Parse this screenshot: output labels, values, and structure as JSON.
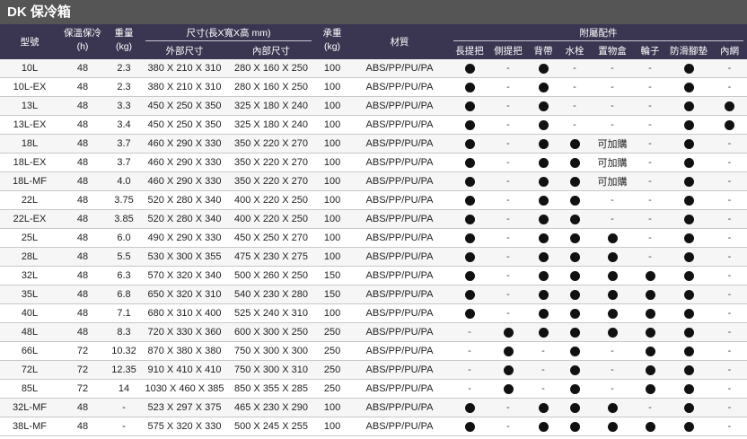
{
  "title": "DK 保冷箱",
  "headers": {
    "model": "型號",
    "hours_label": "保溫保冷",
    "hours_unit": "(h)",
    "weight_label": "重量",
    "weight_unit": "(kg)",
    "size_group": "尺寸(長X寬X高 mm)",
    "outer": "外部尺寸",
    "inner": "內部尺寸",
    "load_label": "承重",
    "load_unit": "(kg)",
    "material": "材質",
    "accessories_group": "附屬配件",
    "accessories": [
      "長提把",
      "側提把",
      "背帶",
      "水栓",
      "置物盒",
      "輪子",
      "防滑腳墊",
      "內網"
    ]
  },
  "rows": [
    {
      "model": "10L",
      "hours": "48",
      "weight": "2.3",
      "outer": "380 X 210 X 310",
      "inner": "280 X 160 X 250",
      "load": "100",
      "material": "ABS/PP/PU/PA",
      "acc": [
        "dot",
        "-",
        "dot",
        "-",
        "-",
        "-",
        "dot",
        "-"
      ]
    },
    {
      "model": "10L-EX",
      "hours": "48",
      "weight": "2.3",
      "outer": "380 X 210 X 310",
      "inner": "280 X 160 X 250",
      "load": "100",
      "material": "ABS/PP/PU/PA",
      "acc": [
        "dot",
        "-",
        "dot",
        "-",
        "-",
        "-",
        "dot",
        "-"
      ]
    },
    {
      "model": "13L",
      "hours": "48",
      "weight": "3.3",
      "outer": "450 X 250 X 350",
      "inner": "325 X 180 X 240",
      "load": "100",
      "material": "ABS/PP/PU/PA",
      "acc": [
        "dot",
        "-",
        "dot",
        "-",
        "-",
        "-",
        "dot",
        "dot"
      ]
    },
    {
      "model": "13L-EX",
      "hours": "48",
      "weight": "3.4",
      "outer": "450 X 250 X 350",
      "inner": "325 X 180 X 240",
      "load": "100",
      "material": "ABS/PP/PU/PA",
      "acc": [
        "dot",
        "-",
        "dot",
        "-",
        "-",
        "-",
        "dot",
        "dot"
      ]
    },
    {
      "model": "18L",
      "hours": "48",
      "weight": "3.7",
      "outer": "460 X 290 X 330",
      "inner": "350 X 220 X 270",
      "load": "100",
      "material": "ABS/PP/PU/PA",
      "acc": [
        "dot",
        "-",
        "dot",
        "dot",
        "可加購",
        "-",
        "dot",
        "-"
      ]
    },
    {
      "model": "18L-EX",
      "hours": "48",
      "weight": "3.7",
      "outer": "460 X 290 X 330",
      "inner": "350 X 220 X 270",
      "load": "100",
      "material": "ABS/PP/PU/PA",
      "acc": [
        "dot",
        "-",
        "dot",
        "dot",
        "可加購",
        "-",
        "dot",
        "-"
      ]
    },
    {
      "model": "18L-MF",
      "hours": "48",
      "weight": "4.0",
      "outer": "460 X 290 X 330",
      "inner": "350 X 220 X 270",
      "load": "100",
      "material": "ABS/PP/PU/PA",
      "acc": [
        "dot",
        "-",
        "dot",
        "dot",
        "可加購",
        "-",
        "dot",
        "-"
      ]
    },
    {
      "model": "22L",
      "hours": "48",
      "weight": "3.75",
      "outer": "520 X 280 X 340",
      "inner": "400 X 220 X 250",
      "load": "100",
      "material": "ABS/PP/PU/PA",
      "acc": [
        "dot",
        "-",
        "dot",
        "dot",
        "-",
        "-",
        "dot",
        "-"
      ]
    },
    {
      "model": "22L-EX",
      "hours": "48",
      "weight": "3.85",
      "outer": "520 X 280 X 340",
      "inner": "400 X 220 X 250",
      "load": "100",
      "material": "ABS/PP/PU/PA",
      "acc": [
        "dot",
        "-",
        "dot",
        "dot",
        "-",
        "-",
        "dot",
        "-"
      ]
    },
    {
      "model": "25L",
      "hours": "48",
      "weight": "6.0",
      "outer": "490 X 290 X 330",
      "inner": "450 X 250 X 270",
      "load": "100",
      "material": "ABS/PP/PU/PA",
      "acc": [
        "dot",
        "-",
        "dot",
        "dot",
        "dot",
        "-",
        "dot",
        "-"
      ]
    },
    {
      "model": "28L",
      "hours": "48",
      "weight": "5.5",
      "outer": "530 X 300 X 355",
      "inner": "475 X 230 X 275",
      "load": "100",
      "material": "ABS/PP/PU/PA",
      "acc": [
        "dot",
        "-",
        "dot",
        "dot",
        "dot",
        "-",
        "dot",
        "-"
      ]
    },
    {
      "model": "32L",
      "hours": "48",
      "weight": "6.3",
      "outer": "570 X 320 X 340",
      "inner": "500 X 260 X 250",
      "load": "150",
      "material": "ABS/PP/PU/PA",
      "acc": [
        "dot",
        "-",
        "dot",
        "dot",
        "dot",
        "dot",
        "dot",
        "-"
      ]
    },
    {
      "model": "35L",
      "hours": "48",
      "weight": "6.8",
      "outer": "650 X 320 X 310",
      "inner": "540 X 230 X 280",
      "load": "150",
      "material": "ABS/PP/PU/PA",
      "acc": [
        "dot",
        "-",
        "dot",
        "dot",
        "dot",
        "dot",
        "dot",
        "-"
      ]
    },
    {
      "model": "40L",
      "hours": "48",
      "weight": "7.1",
      "outer": "680 X 310 X 400",
      "inner": "525 X 240 X 310",
      "load": "100",
      "material": "ABS/PP/PU/PA",
      "acc": [
        "dot",
        "-",
        "dot",
        "dot",
        "dot",
        "dot",
        "dot",
        "-"
      ]
    },
    {
      "model": "48L",
      "hours": "48",
      "weight": "8.3",
      "outer": "720 X 330 X 360",
      "inner": "600 X 300 X 250",
      "load": "250",
      "material": "ABS/PP/PU/PA",
      "acc": [
        "-",
        "dot",
        "dot",
        "dot",
        "dot",
        "dot",
        "dot",
        "-"
      ]
    },
    {
      "model": "66L",
      "hours": "72",
      "weight": "10.32",
      "outer": "870 X 380 X 380",
      "inner": "750 X 300 X 300",
      "load": "250",
      "material": "ABS/PP/PU/PA",
      "acc": [
        "-",
        "dot",
        "-",
        "dot",
        "-",
        "dot",
        "dot",
        "-"
      ]
    },
    {
      "model": "72L",
      "hours": "72",
      "weight": "12.35",
      "outer": "910 X 410 X 410",
      "inner": "750 X 300 X 310",
      "load": "250",
      "material": "ABS/PP/PU/PA",
      "acc": [
        "-",
        "dot",
        "-",
        "dot",
        "-",
        "dot",
        "dot",
        "-"
      ]
    },
    {
      "model": "85L",
      "hours": "72",
      "weight": "14",
      "outer": "1030 X 460 X 385",
      "inner": "850 X 355 X 285",
      "load": "250",
      "material": "ABS/PP/PU/PA",
      "acc": [
        "-",
        "dot",
        "-",
        "dot",
        "-",
        "dot",
        "dot",
        "-"
      ]
    },
    {
      "model": "32L-MF",
      "hours": "48",
      "weight": "-",
      "outer": "523 X 297 X 375",
      "inner": "465 X 230 X 290",
      "load": "100",
      "material": "ABS/PP/PU/PA",
      "acc": [
        "dot",
        "-",
        "dot",
        "dot",
        "dot",
        "-",
        "dot",
        "-"
      ]
    },
    {
      "model": "38L-MF",
      "hours": "48",
      "weight": "-",
      "outer": "575 X 320 X 330",
      "inner": "500 X 245 X 255",
      "load": "100",
      "material": "ABS/PP/PU/PA",
      "acc": [
        "dot",
        "-",
        "dot",
        "dot",
        "dot",
        "dot",
        "dot",
        "-"
      ]
    }
  ]
}
